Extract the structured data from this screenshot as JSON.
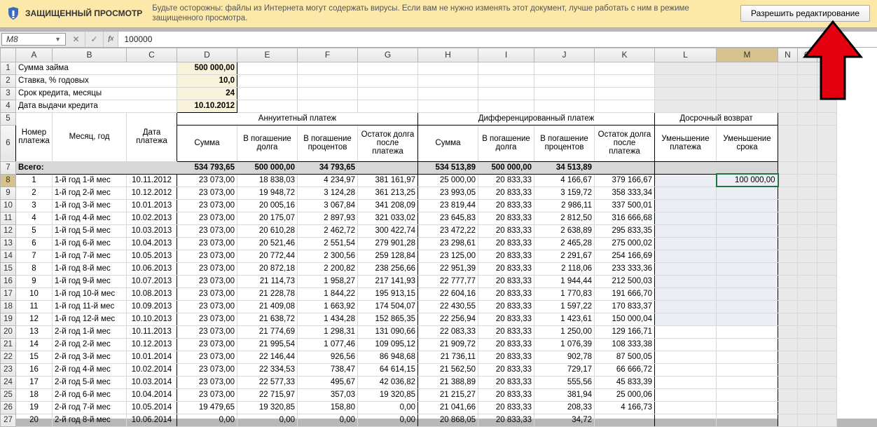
{
  "protected_view": {
    "title": "ЗАЩИЩЕННЫЙ ПРОСМОТР",
    "message": "Будьте осторожны: файлы из Интернета могут содержать вирусы. Если вам не нужно изменять этот документ, лучше работать с ним в режиме защищенного просмотра.",
    "enable_button": "Разрешить редактирование"
  },
  "name_box": "M8",
  "formula_value": "100000",
  "col_headers": [
    "",
    "A",
    "B",
    "C",
    "D",
    "E",
    "F",
    "G",
    "H",
    "I",
    "J",
    "K",
    "L",
    "M",
    "N",
    "O",
    "P"
  ],
  "row_headers": [
    "1",
    "2",
    "3",
    "4",
    "5",
    "6",
    "7",
    "8",
    "9",
    "10",
    "11",
    "12",
    "13",
    "14",
    "15",
    "16",
    "17",
    "18",
    "19",
    "20",
    "21",
    "22",
    "23",
    "24",
    "25",
    "26",
    "27"
  ],
  "loan_info": {
    "r1_label": "Сумма займа",
    "r1_val": "500 000,00",
    "r2_label": "Ставка, % годовых",
    "r2_val": "10,0",
    "r3_label": "Срок кредита, месяцы",
    "r3_val": "24",
    "r4_label": "Дата выдачи кредита",
    "r4_val": "10.10.2012"
  },
  "headers": {
    "annuity": "Аннуитетный платеж",
    "diff": "Дифференцированный платеж",
    "early": "Досрочный возврат",
    "num": "Номер платежа",
    "monyr": "Месяц, год",
    "paydate": "Дата платежа",
    "sum": "Сумма",
    "principal": "В погашение долга",
    "interest": "В погашение процентов",
    "balance_after": "Остаток долга после платежа",
    "balance_after2": "Остаток долга после платежа",
    "dec_pay": "Уменьшение платежа",
    "dec_term": "Уменьшение срока",
    "total": "Всего:"
  },
  "tot": {
    "a_sum": "534 793,65",
    "a_pr": "500 000,00",
    "a_int": "34 793,65",
    "d_sum": "534 513,89",
    "d_pr": "500 000,00",
    "d_int": "34 513,89"
  },
  "rows": [
    {
      "n": "1",
      "my": "1-й год 1-й мес",
      "d": "10.11.2012",
      "as": "23 073,00",
      "ap": "18 838,03",
      "ai": "4 234,97",
      "ab": "381 161,97",
      "ds": "25 000,00",
      "dp": "20 833,33",
      "di": "4 166,67",
      "db": "379 166,67",
      "m": "100 000,00"
    },
    {
      "n": "2",
      "my": "1-й год 2-й мес",
      "d": "10.12.2012",
      "as": "23 073,00",
      "ap": "19 948,72",
      "ai": "3 124,28",
      "ab": "361 213,25",
      "ds": "23 993,05",
      "dp": "20 833,33",
      "di": "3 159,72",
      "db": "358 333,34",
      "m": ""
    },
    {
      "n": "3",
      "my": "1-й год 3-й мес",
      "d": "10.01.2013",
      "as": "23 073,00",
      "ap": "20 005,16",
      "ai": "3 067,84",
      "ab": "341 208,09",
      "ds": "23 819,44",
      "dp": "20 833,33",
      "di": "2 986,11",
      "db": "337 500,01",
      "m": ""
    },
    {
      "n": "4",
      "my": "1-й год 4-й мес",
      "d": "10.02.2013",
      "as": "23 073,00",
      "ap": "20 175,07",
      "ai": "2 897,93",
      "ab": "321 033,02",
      "ds": "23 645,83",
      "dp": "20 833,33",
      "di": "2 812,50",
      "db": "316 666,68",
      "m": ""
    },
    {
      "n": "5",
      "my": "1-й год 5-й мес",
      "d": "10.03.2013",
      "as": "23 073,00",
      "ap": "20 610,28",
      "ai": "2 462,72",
      "ab": "300 422,74",
      "ds": "23 472,22",
      "dp": "20 833,33",
      "di": "2 638,89",
      "db": "295 833,35",
      "m": ""
    },
    {
      "n": "6",
      "my": "1-й год 6-й мес",
      "d": "10.04.2013",
      "as": "23 073,00",
      "ap": "20 521,46",
      "ai": "2 551,54",
      "ab": "279 901,28",
      "ds": "23 298,61",
      "dp": "20 833,33",
      "di": "2 465,28",
      "db": "275 000,02",
      "m": ""
    },
    {
      "n": "7",
      "my": "1-й год 7-й мес",
      "d": "10.05.2013",
      "as": "23 073,00",
      "ap": "20 772,44",
      "ai": "2 300,56",
      "ab": "259 128,84",
      "ds": "23 125,00",
      "dp": "20 833,33",
      "di": "2 291,67",
      "db": "254 166,69",
      "m": ""
    },
    {
      "n": "8",
      "my": "1-й год 8-й мес",
      "d": "10.06.2013",
      "as": "23 073,00",
      "ap": "20 872,18",
      "ai": "2 200,82",
      "ab": "238 256,66",
      "ds": "22 951,39",
      "dp": "20 833,33",
      "di": "2 118,06",
      "db": "233 333,36",
      "m": ""
    },
    {
      "n": "9",
      "my": "1-й год 9-й мес",
      "d": "10.07.2013",
      "as": "23 073,00",
      "ap": "21 114,73",
      "ai": "1 958,27",
      "ab": "217 141,93",
      "ds": "22 777,77",
      "dp": "20 833,33",
      "di": "1 944,44",
      "db": "212 500,03",
      "m": ""
    },
    {
      "n": "10",
      "my": "1-й год 10-й мес",
      "d": "10.08.2013",
      "as": "23 073,00",
      "ap": "21 228,78",
      "ai": "1 844,22",
      "ab": "195 913,15",
      "ds": "22 604,16",
      "dp": "20 833,33",
      "di": "1 770,83",
      "db": "191 666,70",
      "m": ""
    },
    {
      "n": "11",
      "my": "1-й год 11-й мес",
      "d": "10.09.2013",
      "as": "23 073,00",
      "ap": "21 409,08",
      "ai": "1 663,92",
      "ab": "174 504,07",
      "ds": "22 430,55",
      "dp": "20 833,33",
      "di": "1 597,22",
      "db": "170 833,37",
      "m": ""
    },
    {
      "n": "12",
      "my": "1-й год 12-й мес",
      "d": "10.10.2013",
      "as": "23 073,00",
      "ap": "21 638,72",
      "ai": "1 434,28",
      "ab": "152 865,35",
      "ds": "22 256,94",
      "dp": "20 833,33",
      "di": "1 423,61",
      "db": "150 000,04",
      "m": ""
    },
    {
      "n": "13",
      "my": "2-й год 1-й мес",
      "d": "10.11.2013",
      "as": "23 073,00",
      "ap": "21 774,69",
      "ai": "1 298,31",
      "ab": "131 090,66",
      "ds": "22 083,33",
      "dp": "20 833,33",
      "di": "1 250,00",
      "db": "129 166,71",
      "m": ""
    },
    {
      "n": "14",
      "my": "2-й год 2-й мес",
      "d": "10.12.2013",
      "as": "23 073,00",
      "ap": "21 995,54",
      "ai": "1 077,46",
      "ab": "109 095,12",
      "ds": "21 909,72",
      "dp": "20 833,33",
      "di": "1 076,39",
      "db": "108 333,38",
      "m": ""
    },
    {
      "n": "15",
      "my": "2-й год 3-й мес",
      "d": "10.01.2014",
      "as": "23 073,00",
      "ap": "22 146,44",
      "ai": "926,56",
      "ab": "86 948,68",
      "ds": "21 736,11",
      "dp": "20 833,33",
      "di": "902,78",
      "db": "87 500,05",
      "m": ""
    },
    {
      "n": "16",
      "my": "2-й год 4-й мес",
      "d": "10.02.2014",
      "as": "23 073,00",
      "ap": "22 334,53",
      "ai": "738,47",
      "ab": "64 614,15",
      "ds": "21 562,50",
      "dp": "20 833,33",
      "di": "729,17",
      "db": "66 666,72",
      "m": ""
    },
    {
      "n": "17",
      "my": "2-й год 5-й мес",
      "d": "10.03.2014",
      "as": "23 073,00",
      "ap": "22 577,33",
      "ai": "495,67",
      "ab": "42 036,82",
      "ds": "21 388,89",
      "dp": "20 833,33",
      "di": "555,56",
      "db": "45 833,39",
      "m": ""
    },
    {
      "n": "18",
      "my": "2-й год 6-й мес",
      "d": "10.04.2014",
      "as": "23 073,00",
      "ap": "22 715,97",
      "ai": "357,03",
      "ab": "19 320,85",
      "ds": "21 215,27",
      "dp": "20 833,33",
      "di": "381,94",
      "db": "25 000,06",
      "m": ""
    },
    {
      "n": "19",
      "my": "2-й год 7-й мес",
      "d": "10.05.2014",
      "as": "19 479,65",
      "ap": "19 320,85",
      "ai": "158,80",
      "ab": "0,00",
      "ds": "21 041,66",
      "dp": "20 833,33",
      "di": "208,33",
      "db": "4 166,73",
      "m": ""
    },
    {
      "n": "20",
      "my": "2-й год 8-й мес",
      "d": "10.06.2014",
      "as": "0,00",
      "ap": "0,00",
      "ai": "0,00",
      "ab": "0,00",
      "ds": "20 868,05",
      "dp": "20 833,33",
      "di": "34,72",
      "db": "",
      "m": ""
    }
  ],
  "col_widths": {
    "rh": 22,
    "A": 52,
    "B": 106,
    "C": 72,
    "D": 86,
    "E": 86,
    "F": 86,
    "G": 86,
    "H": 86,
    "I": 80,
    "J": 86,
    "K": 86,
    "L": 88,
    "M": 88,
    "N": 28,
    "O": 28,
    "P": 28
  }
}
